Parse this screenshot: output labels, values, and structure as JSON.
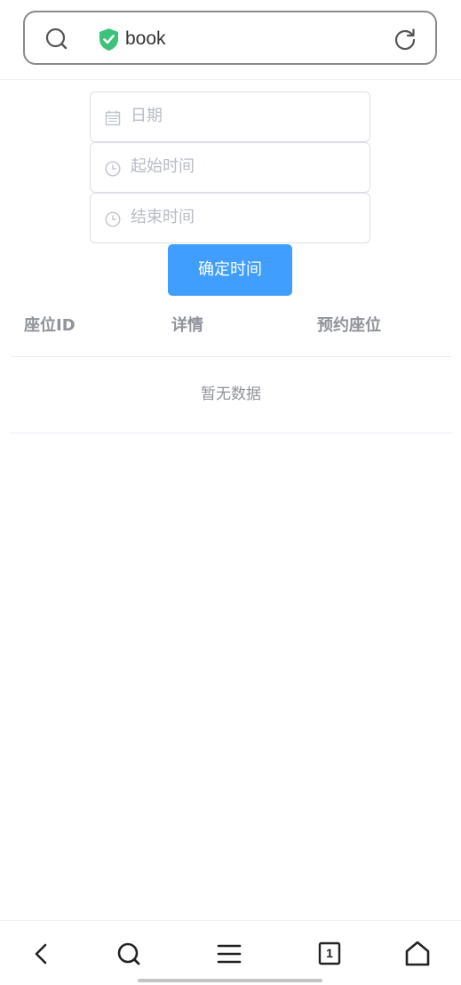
{
  "browser": {
    "address_text": "book",
    "colors": {
      "secure_shield": "#3cc27b"
    }
  },
  "form": {
    "date_placeholder": "日期",
    "start_time_placeholder": "起始时间",
    "end_time_placeholder": "结束时间",
    "confirm_label": "确定时间",
    "colors": {
      "primary": "#409eff"
    }
  },
  "table": {
    "columns": [
      "座位ID",
      "详情",
      "预约座位"
    ],
    "empty_text": "暂无数据"
  },
  "bottom_nav": {
    "tab_count": "1"
  }
}
